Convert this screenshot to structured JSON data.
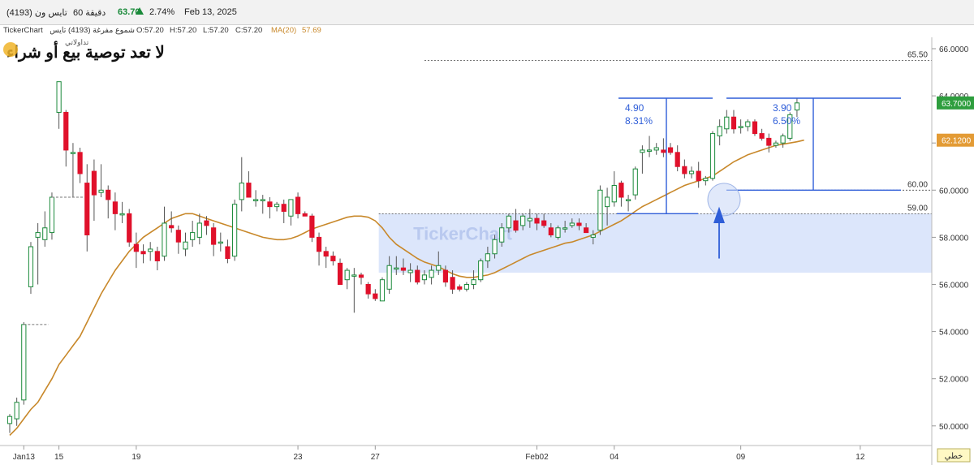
{
  "header": {
    "symbol": "تايس ون (4193)",
    "interval": "60 دقيقة",
    "price": "63.70",
    "up_icon": "triangle-up-icon",
    "change_pct": "2.74%",
    "date": "Feb 13, 2025"
  },
  "info": {
    "brand": "TickerChart",
    "desc": "شموع مفرغة (4193) تايس ون",
    "open": "O:57.20",
    "high": "H:57.20",
    "low": "L:57.20",
    "close": "C:57.20",
    "ma_label": "MA(20)",
    "ma_value": "57.69"
  },
  "overlay": {
    "disclaimer": "لا تعد توصية بيع أو شراء",
    "watermark": "TickerChart",
    "logo_text": "تداولاتي",
    "move1_value": "4.90",
    "move1_pct": "8.31%",
    "move2_value": "3.90",
    "move2_pct": "6.50%",
    "level_6550": "65.50",
    "level_6000": "60.00",
    "level_5900": "59.00"
  },
  "price_tags": {
    "last": "63.7000",
    "ma": "62.1200"
  },
  "footer": {
    "scale_button": "خطي"
  },
  "colors": {
    "up": "#1a8a3a",
    "down": "#e0112b",
    "ma": "#c8882a",
    "annotation": "#2f5ed8",
    "zone": "#d8e3fb",
    "last_tag": "#2e9e3e",
    "ma_tag": "#e39b35"
  },
  "chart_data": {
    "type": "candlestick",
    "ylim": [
      49.5,
      66.5
    ],
    "yticks": [
      "66.0000",
      "64.0000",
      "62.0000",
      "60.0000",
      "58.0000",
      "56.0000",
      "54.0000",
      "52.0000",
      "50.0000"
    ],
    "xticks": [
      "Jan13",
      "15",
      "19",
      "23",
      "27",
      "Feb02",
      "04",
      "09",
      "12"
    ],
    "candles": [
      {
        "o": 50.1,
        "h": 50.5,
        "l": 49.7,
        "c": 50.4
      },
      {
        "o": 50.3,
        "h": 51.2,
        "l": 50.0,
        "c": 51.0
      },
      {
        "o": 51.1,
        "h": 54.4,
        "l": 50.9,
        "c": 54.3
      },
      {
        "o": 55.9,
        "h": 57.8,
        "l": 55.6,
        "c": 57.6
      },
      {
        "o": 58.0,
        "h": 58.6,
        "l": 56.0,
        "c": 58.2
      },
      {
        "o": 57.9,
        "h": 59.1,
        "l": 57.6,
        "c": 58.4
      },
      {
        "o": 58.2,
        "h": 59.9,
        "l": 57.9,
        "c": 59.7
      },
      {
        "o": 63.3,
        "h": 64.6,
        "l": 62.6,
        "c": 64.6
      },
      {
        "o": 63.3,
        "h": 63.4,
        "l": 61.0,
        "c": 61.7
      },
      {
        "o": 61.6,
        "h": 62.0,
        "l": 59.7,
        "c": 61.6
      },
      {
        "o": 61.6,
        "h": 61.8,
        "l": 60.3,
        "c": 60.7
      },
      {
        "o": 60.3,
        "h": 61.1,
        "l": 57.4,
        "c": 58.1
      },
      {
        "o": 60.8,
        "h": 61.3,
        "l": 58.7,
        "c": 59.8
      },
      {
        "o": 59.9,
        "h": 61.1,
        "l": 59.7,
        "c": 60.0
      },
      {
        "o": 60.0,
        "h": 60.2,
        "l": 58.8,
        "c": 59.6
      },
      {
        "o": 59.5,
        "h": 59.9,
        "l": 58.3,
        "c": 59.0
      },
      {
        "o": 59.0,
        "h": 59.5,
        "l": 58.6,
        "c": 59.0
      },
      {
        "o": 59.0,
        "h": 59.2,
        "l": 57.6,
        "c": 57.8
      },
      {
        "o": 57.7,
        "h": 58.2,
        "l": 56.7,
        "c": 57.4
      },
      {
        "o": 57.4,
        "h": 57.7,
        "l": 56.9,
        "c": 57.3
      },
      {
        "o": 57.4,
        "h": 57.8,
        "l": 57.0,
        "c": 57.5
      },
      {
        "o": 57.4,
        "h": 57.6,
        "l": 56.6,
        "c": 57.0
      },
      {
        "o": 57.2,
        "h": 59.3,
        "l": 57.0,
        "c": 58.6
      },
      {
        "o": 58.5,
        "h": 59.1,
        "l": 58.2,
        "c": 58.4
      },
      {
        "o": 58.3,
        "h": 58.5,
        "l": 57.3,
        "c": 57.8
      },
      {
        "o": 57.5,
        "h": 58.2,
        "l": 57.2,
        "c": 57.8
      },
      {
        "o": 57.9,
        "h": 58.7,
        "l": 57.6,
        "c": 58.2
      },
      {
        "o": 58.0,
        "h": 59.0,
        "l": 57.7,
        "c": 58.6
      },
      {
        "o": 58.7,
        "h": 58.9,
        "l": 58.1,
        "c": 58.5
      },
      {
        "o": 58.4,
        "h": 58.6,
        "l": 57.2,
        "c": 57.7
      },
      {
        "o": 57.8,
        "h": 58.2,
        "l": 57.4,
        "c": 57.8
      },
      {
        "o": 57.6,
        "h": 57.9,
        "l": 56.9,
        "c": 57.1
      },
      {
        "o": 57.2,
        "h": 59.6,
        "l": 57.0,
        "c": 59.4
      },
      {
        "o": 59.6,
        "h": 61.4,
        "l": 59.1,
        "c": 60.3
      },
      {
        "o": 60.3,
        "h": 60.8,
        "l": 59.9,
        "c": 59.7
      },
      {
        "o": 59.6,
        "h": 60.0,
        "l": 59.3,
        "c": 59.6
      },
      {
        "o": 59.6,
        "h": 59.8,
        "l": 59.0,
        "c": 59.6
      },
      {
        "o": 59.5,
        "h": 59.7,
        "l": 58.8,
        "c": 59.3
      },
      {
        "o": 59.3,
        "h": 59.5,
        "l": 59.1,
        "c": 59.4
      },
      {
        "o": 59.4,
        "h": 59.6,
        "l": 58.6,
        "c": 59.1
      },
      {
        "o": 58.9,
        "h": 59.6,
        "l": 58.5,
        "c": 59.6
      },
      {
        "o": 59.7,
        "h": 59.9,
        "l": 58.8,
        "c": 59.0
      },
      {
        "o": 59.0,
        "h": 59.1,
        "l": 58.9,
        "c": 58.9
      },
      {
        "o": 58.9,
        "h": 59.0,
        "l": 57.8,
        "c": 58.0
      },
      {
        "o": 58.0,
        "h": 58.2,
        "l": 56.8,
        "c": 57.4
      },
      {
        "o": 57.4,
        "h": 57.6,
        "l": 56.7,
        "c": 57.2
      },
      {
        "o": 57.2,
        "h": 57.4,
        "l": 56.8,
        "c": 57.0
      },
      {
        "o": 56.9,
        "h": 57.1,
        "l": 56.0,
        "c": 56.0
      },
      {
        "o": 56.2,
        "h": 56.7,
        "l": 55.8,
        "c": 56.6
      },
      {
        "o": 56.4,
        "h": 56.7,
        "l": 54.8,
        "c": 56.4
      },
      {
        "o": 56.4,
        "h": 56.5,
        "l": 56.0,
        "c": 56.3
      },
      {
        "o": 56.0,
        "h": 56.1,
        "l": 55.4,
        "c": 55.6
      },
      {
        "o": 55.6,
        "h": 55.8,
        "l": 55.3,
        "c": 55.4
      },
      {
        "o": 55.3,
        "h": 56.3,
        "l": 55.3,
        "c": 56.2
      },
      {
        "o": 55.8,
        "h": 57.2,
        "l": 55.6,
        "c": 56.8
      },
      {
        "o": 56.7,
        "h": 57.2,
        "l": 56.4,
        "c": 56.7
      },
      {
        "o": 56.7,
        "h": 57.1,
        "l": 56.4,
        "c": 56.6
      },
      {
        "o": 56.5,
        "h": 56.9,
        "l": 56.1,
        "c": 56.6
      },
      {
        "o": 56.6,
        "h": 56.8,
        "l": 56.0,
        "c": 56.1
      },
      {
        "o": 56.2,
        "h": 56.6,
        "l": 56.0,
        "c": 56.4
      },
      {
        "o": 56.3,
        "h": 56.8,
        "l": 56.0,
        "c": 56.6
      },
      {
        "o": 56.6,
        "h": 57.4,
        "l": 56.4,
        "c": 56.8
      },
      {
        "o": 56.6,
        "h": 56.8,
        "l": 55.9,
        "c": 56.1
      },
      {
        "o": 56.3,
        "h": 56.6,
        "l": 55.6,
        "c": 55.8
      },
      {
        "o": 55.9,
        "h": 56.0,
        "l": 55.7,
        "c": 55.8
      },
      {
        "o": 55.8,
        "h": 56.1,
        "l": 55.7,
        "c": 56.0
      },
      {
        "o": 56.0,
        "h": 56.6,
        "l": 55.8,
        "c": 56.2
      },
      {
        "o": 56.2,
        "h": 57.1,
        "l": 56.1,
        "c": 57.0
      },
      {
        "o": 57.0,
        "h": 57.6,
        "l": 56.7,
        "c": 57.3
      },
      {
        "o": 57.3,
        "h": 58.1,
        "l": 57.1,
        "c": 57.9
      },
      {
        "o": 57.8,
        "h": 58.6,
        "l": 57.6,
        "c": 58.4
      },
      {
        "o": 58.4,
        "h": 59.0,
        "l": 58.2,
        "c": 58.9
      },
      {
        "o": 58.7,
        "h": 59.2,
        "l": 58.2,
        "c": 58.3
      },
      {
        "o": 58.5,
        "h": 59.0,
        "l": 58.3,
        "c": 58.9
      },
      {
        "o": 58.7,
        "h": 59.2,
        "l": 58.4,
        "c": 58.8
      },
      {
        "o": 58.8,
        "h": 59.0,
        "l": 58.3,
        "c": 58.6
      },
      {
        "o": 58.7,
        "h": 59.0,
        "l": 58.4,
        "c": 58.5
      },
      {
        "o": 58.4,
        "h": 58.6,
        "l": 58.0,
        "c": 58.1
      },
      {
        "o": 58.0,
        "h": 58.5,
        "l": 57.9,
        "c": 58.4
      },
      {
        "o": 58.4,
        "h": 58.7,
        "l": 58.2,
        "c": 58.4
      },
      {
        "o": 58.5,
        "h": 58.8,
        "l": 58.4,
        "c": 58.6
      },
      {
        "o": 58.6,
        "h": 58.8,
        "l": 58.3,
        "c": 58.5
      },
      {
        "o": 58.4,
        "h": 58.6,
        "l": 58.2,
        "c": 58.2
      },
      {
        "o": 58.0,
        "h": 58.3,
        "l": 57.7,
        "c": 58.1
      },
      {
        "o": 58.3,
        "h": 60.2,
        "l": 58.1,
        "c": 60.0
      },
      {
        "o": 59.3,
        "h": 60.1,
        "l": 58.5,
        "c": 59.7
      },
      {
        "o": 59.5,
        "h": 60.8,
        "l": 59.3,
        "c": 60.2
      },
      {
        "o": 60.3,
        "h": 60.4,
        "l": 59.3,
        "c": 59.7
      },
      {
        "o": 59.6,
        "h": 59.8,
        "l": 59.1,
        "c": 59.6
      },
      {
        "o": 59.8,
        "h": 61.0,
        "l": 59.6,
        "c": 60.9
      },
      {
        "o": 61.6,
        "h": 61.9,
        "l": 60.7,
        "c": 61.7
      },
      {
        "o": 61.7,
        "h": 62.3,
        "l": 61.4,
        "c": 61.7
      },
      {
        "o": 61.7,
        "h": 62.0,
        "l": 61.5,
        "c": 61.8
      },
      {
        "o": 61.7,
        "h": 62.2,
        "l": 61.4,
        "c": 61.6
      },
      {
        "o": 61.8,
        "h": 62.0,
        "l": 61.5,
        "c": 61.6
      },
      {
        "o": 61.6,
        "h": 61.9,
        "l": 60.8,
        "c": 61.0
      },
      {
        "o": 61.0,
        "h": 61.3,
        "l": 60.5,
        "c": 60.7
      },
      {
        "o": 60.7,
        "h": 61.0,
        "l": 60.5,
        "c": 60.8
      },
      {
        "o": 60.8,
        "h": 61.2,
        "l": 60.1,
        "c": 60.4
      },
      {
        "o": 60.4,
        "h": 60.6,
        "l": 60.2,
        "c": 60.5
      },
      {
        "o": 60.5,
        "h": 62.5,
        "l": 60.4,
        "c": 62.4
      },
      {
        "o": 62.3,
        "h": 63.0,
        "l": 61.9,
        "c": 62.7
      },
      {
        "o": 62.6,
        "h": 63.4,
        "l": 62.4,
        "c": 63.1
      },
      {
        "o": 63.1,
        "h": 63.4,
        "l": 62.4,
        "c": 62.6
      },
      {
        "o": 62.7,
        "h": 63.0,
        "l": 62.4,
        "c": 62.7
      },
      {
        "o": 62.7,
        "h": 63.0,
        "l": 62.5,
        "c": 62.9
      },
      {
        "o": 62.9,
        "h": 63.0,
        "l": 62.3,
        "c": 62.4
      },
      {
        "o": 62.4,
        "h": 62.6,
        "l": 62.1,
        "c": 62.2
      },
      {
        "o": 62.2,
        "h": 62.4,
        "l": 61.6,
        "c": 61.9
      },
      {
        "o": 61.9,
        "h": 62.1,
        "l": 61.8,
        "c": 62.0
      },
      {
        "o": 62.0,
        "h": 62.4,
        "l": 61.8,
        "c": 62.3
      },
      {
        "o": 62.2,
        "h": 63.3,
        "l": 62.1,
        "c": 63.2
      },
      {
        "o": 63.4,
        "h": 63.9,
        "l": 63.1,
        "c": 63.7
      }
    ],
    "ma20": [
      49.6,
      49.9,
      50.3,
      50.7,
      51.0,
      51.5,
      52.0,
      52.6,
      53.0,
      53.4,
      53.8,
      54.4,
      55.0,
      55.6,
      56.1,
      56.6,
      57.0,
      57.4,
      57.7,
      58.0,
      58.2,
      58.4,
      58.6,
      58.8,
      58.9,
      59.0,
      59.0,
      58.9,
      58.8,
      58.7,
      58.6,
      58.5,
      58.4,
      58.3,
      58.2,
      58.1,
      58.0,
      57.95,
      57.9,
      57.9,
      57.95,
      58.05,
      58.2,
      58.35,
      58.45,
      58.55,
      58.65,
      58.75,
      58.85,
      58.9,
      58.9,
      58.85,
      58.7,
      58.4,
      58.0,
      57.7,
      57.5,
      57.3,
      57.1,
      56.95,
      56.85,
      56.75,
      56.6,
      56.45,
      56.35,
      56.3,
      56.3,
      56.35,
      56.4,
      56.5,
      56.65,
      56.8,
      56.95,
      57.1,
      57.25,
      57.35,
      57.45,
      57.55,
      57.65,
      57.75,
      57.8,
      57.9,
      58.0,
      58.1,
      58.25,
      58.4,
      58.55,
      58.7,
      58.9,
      59.1,
      59.3,
      59.45,
      59.6,
      59.75,
      59.9,
      60.05,
      60.2,
      60.3,
      60.4,
      60.5,
      60.6,
      60.8,
      61.0,
      61.2,
      61.35,
      61.5,
      61.6,
      61.7,
      61.8,
      61.9,
      61.95,
      62.0,
      62.05,
      62.12
    ]
  }
}
